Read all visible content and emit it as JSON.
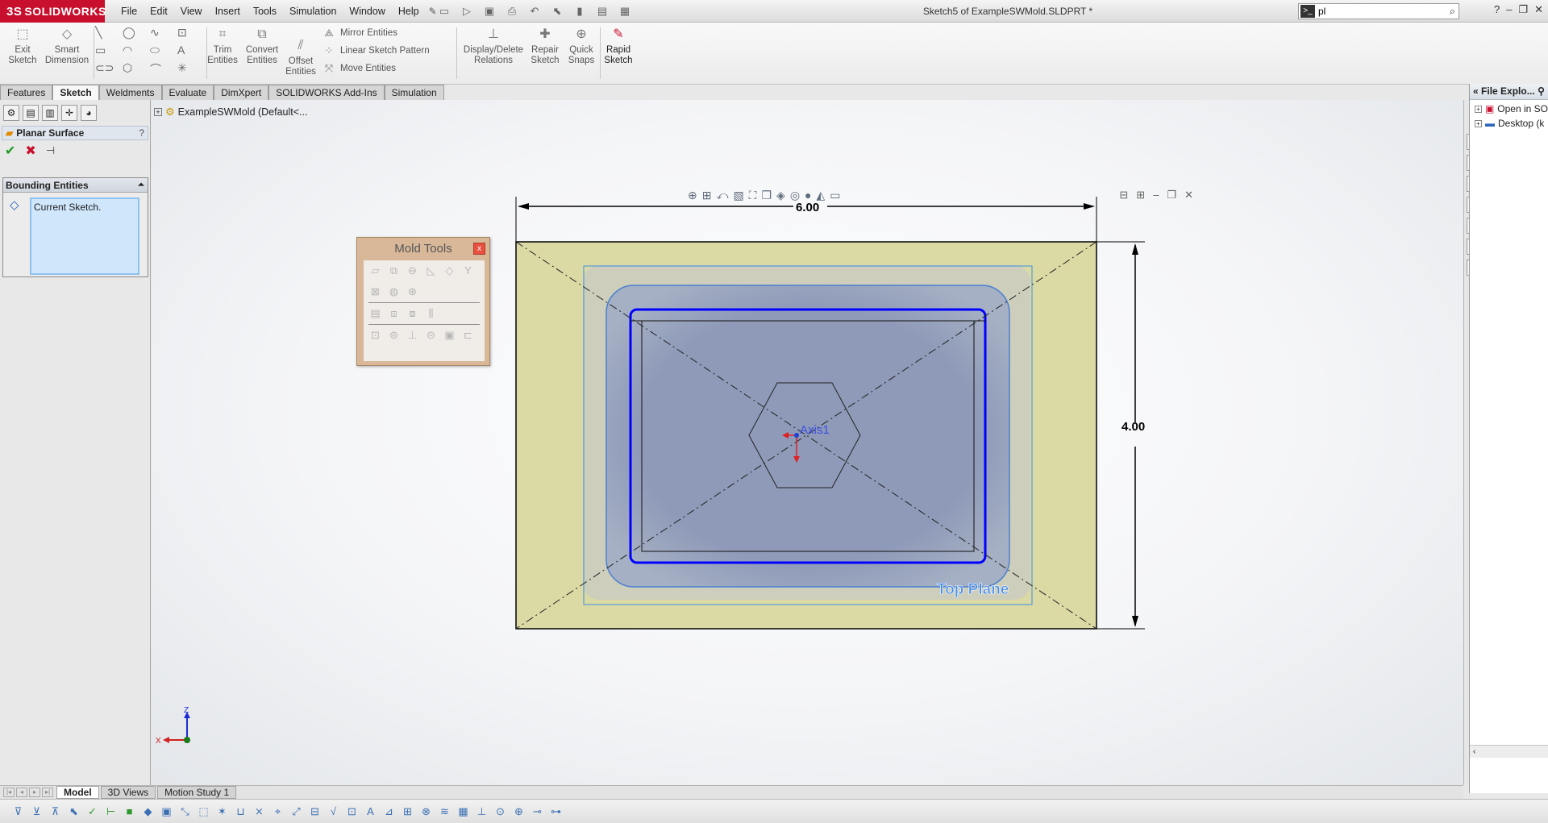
{
  "app": {
    "brand": "SOLIDWORKS",
    "brand_mark": "3S",
    "document_title": "Sketch5 of ExampleSWMold.SLDPRT *",
    "search_value": "pl",
    "search_cmd_glyph": ">_"
  },
  "menu": [
    "File",
    "Edit",
    "View",
    "Insert",
    "Tools",
    "Simulation",
    "Window",
    "Help"
  ],
  "commands": {
    "exit_sketch": "Exit\nSketch",
    "smart_dimension": "Smart\nDimension",
    "trim_entities": "Trim\nEntities",
    "convert_entities": "Convert\nEntities",
    "offset_entities": "Offset\nEntities",
    "mirror_entities": "Mirror Entities",
    "linear_sketch_pattern": "Linear Sketch Pattern",
    "move_entities": "Move Entities",
    "display_delete_relations": "Display/Delete\nRelations",
    "repair_sketch": "Repair\nSketch",
    "quick_snaps": "Quick\nSnaps",
    "rapid_sketch": "Rapid\nSketch"
  },
  "tabs": [
    "Features",
    "Sketch",
    "Weldments",
    "Evaluate",
    "DimXpert",
    "SOLIDWORKS Add-Ins",
    "Simulation"
  ],
  "active_tab": "Sketch",
  "property_manager": {
    "title": "Planar Surface",
    "help": "?",
    "group_title": "Bounding Entities",
    "selection": "Current Sketch."
  },
  "feature_tree": {
    "root": "ExampleSWMold  (Default<..."
  },
  "mold_tools": {
    "title": "Mold Tools",
    "close": "x"
  },
  "sketch": {
    "width_dim": "6.00",
    "height_dim": "4.00",
    "axis_label": "Axis1",
    "plane_label": "Top Plane"
  },
  "triad": {
    "z": "Z",
    "x": "X"
  },
  "task_pane": {
    "title": "File Explo...",
    "items": [
      "Open in SO",
      "Desktop (k"
    ]
  },
  "bottom_tabs": [
    "Model",
    "3D Views",
    "Motion Study 1"
  ],
  "active_bottom_tab": "Model",
  "colors": {
    "accent": "#c8102e",
    "sketch_blue": "#0000ff",
    "face_tan": "#dcdaa4",
    "cavity": "#8e9ab8"
  }
}
